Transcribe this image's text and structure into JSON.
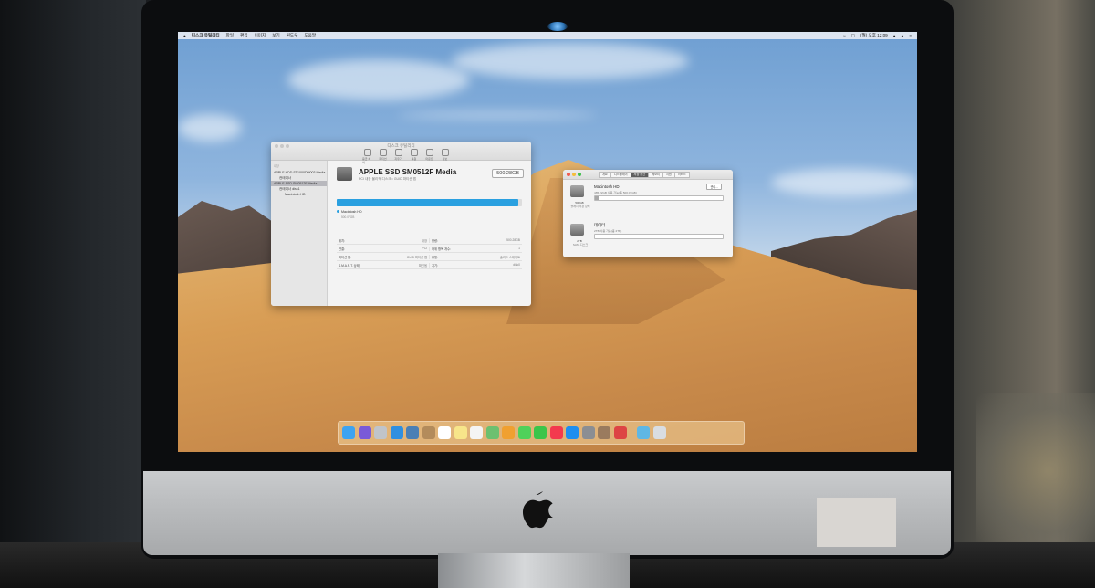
{
  "menubar": {
    "app_name": "디스크 유틸리티",
    "items": [
      "파일",
      "편집",
      "이미지",
      "보기",
      "윈도우",
      "도움말"
    ],
    "clock": "(월) 오후 12:09"
  },
  "disk_utility": {
    "window_title": "디스크 유틸리티",
    "toolbar": [
      "응급 처치",
      "파티션",
      "지우기",
      "복원",
      "마운트",
      "정보"
    ],
    "sidebar_header": "내장",
    "sidebar_items": [
      {
        "label": "APPLE HDD ST1000DM003 Media",
        "level": 1,
        "selected": false
      },
      {
        "label": "컨테이너",
        "level": 2,
        "selected": false
      },
      {
        "label": "APPLE SSD SM0512F Media",
        "level": 1,
        "selected": true
      },
      {
        "label": "컨테이너 disk1",
        "level": 2,
        "selected": false
      },
      {
        "label": "Macintosh HD",
        "level": 3,
        "selected": false
      }
    ],
    "disk_name": "APPLE SSD SM0512F Media",
    "disk_desc": "PCI 내장 물리적 디스크 • GUID 파티션 맵",
    "disk_size": "500.28GB",
    "usage_fraction": 0.98,
    "volume_name": "Macintosh HD",
    "volume_size": "500.07GB",
    "info_rows": [
      [
        {
          "k": "위치:",
          "v": "내장"
        },
        {
          "k": "용량:",
          "v": "500.28GB"
        }
      ],
      [
        {
          "k": "연결:",
          "v": "PCI"
        },
        {
          "k": "하위 항목 개수:",
          "v": "1"
        }
      ],
      [
        {
          "k": "파티션 맵:",
          "v": "GUID 파티션 맵"
        },
        {
          "k": "유형:",
          "v": "솔리드 스테이트"
        }
      ],
      [
        {
          "k": "S.M.A.R.T. 상태:",
          "v": "확인됨"
        },
        {
          "k": "기기:",
          "v": "disk0"
        }
      ]
    ]
  },
  "storage_info": {
    "tabs": [
      "개요",
      "디스플레이",
      "저장 공간",
      "메모리",
      "지원",
      "서비스"
    ],
    "selected_tab": 2,
    "drives": [
      {
        "name": "Macintosh HD",
        "desc": "485.22GB 사용 가능(총 500.07GB)",
        "capacity": "500GB",
        "type": "플래시 저장 장치",
        "used_fraction": 0.03,
        "button": "관리..."
      },
      {
        "name": "데이터",
        "desc": "2TB 사용 가능(총 2TB)",
        "capacity": "2TB",
        "type": "SATA 디스크",
        "used_fraction": 0.0
      }
    ]
  },
  "dock": {
    "icons": [
      "finder-icon",
      "siri-icon",
      "launchpad-icon",
      "safari-icon",
      "photo-browser-icon",
      "contacts-icon",
      "calendar-icon",
      "notes-icon",
      "reminders-icon",
      "maps-icon",
      "photos-icon",
      "messages-icon",
      "facetime-icon",
      "music-icon",
      "app-store-icon",
      "system-preferences-icon",
      "migration-icon",
      "game-icon",
      "downloads-icon",
      "trash-icon"
    ],
    "colors": [
      "#3ea3f0",
      "#7a5ad8",
      "#c0c4ca",
      "#2f8fe0",
      "#4a7fb5",
      "#b38b5b",
      "#ffffff",
      "#f7e58a",
      "#f4f4f4",
      "#6cc070",
      "#f0a030",
      "#4fd15a",
      "#3bc54a",
      "#f33a4e",
      "#1e8ef0",
      "#8b8e93",
      "#9a7b5e",
      "#d44",
      "#5fb7e5",
      "#d9dde2"
    ]
  }
}
